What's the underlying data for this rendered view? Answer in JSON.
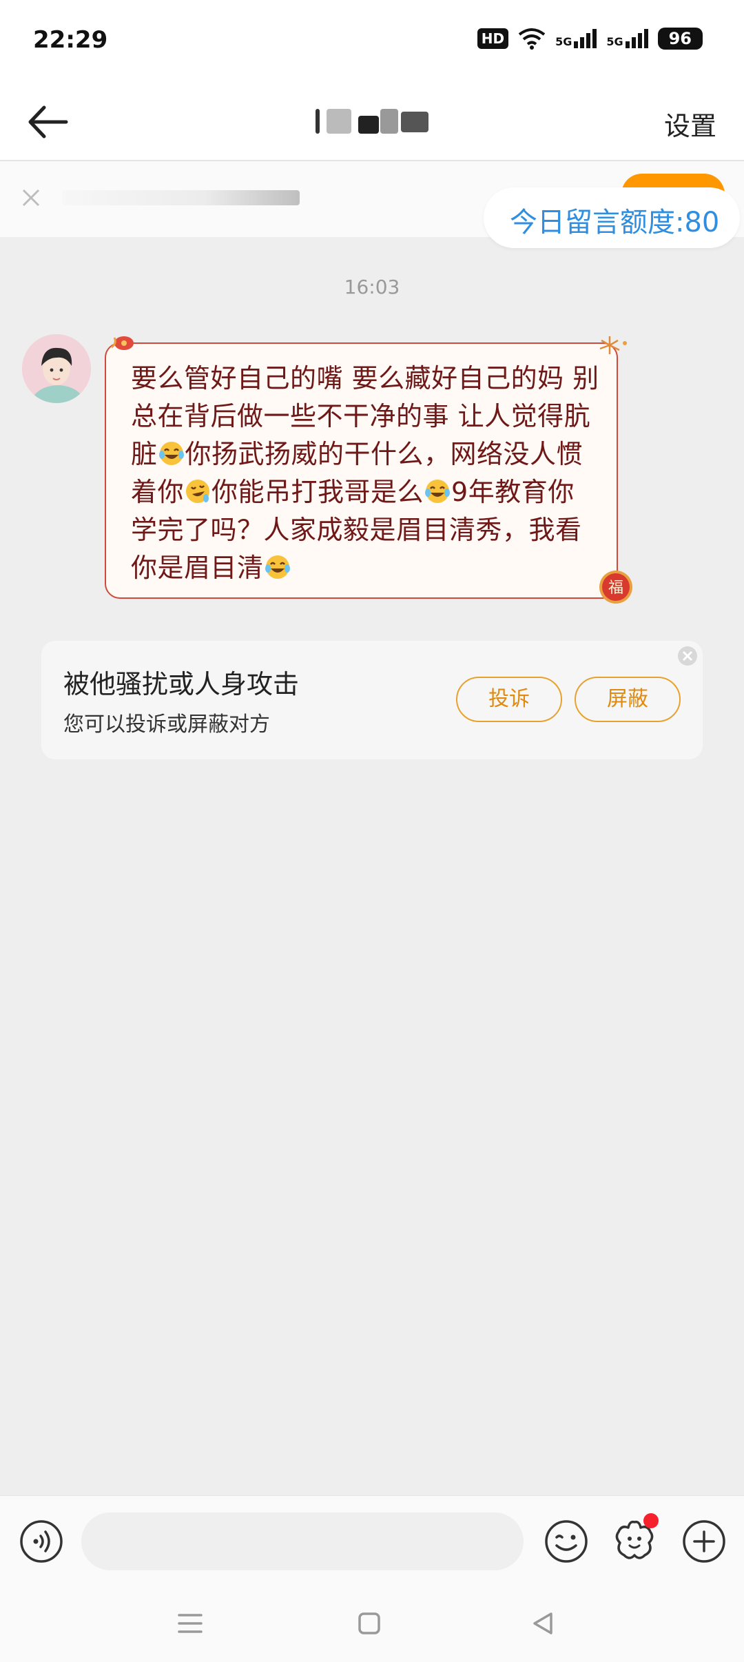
{
  "status_bar": {
    "time": "22:29",
    "hd_label": "HD",
    "network_label_1": "5G",
    "network_label_2": "5G",
    "battery": "96"
  },
  "header": {
    "settings_label": "设置"
  },
  "notice": {
    "quota_text": "今日留言额度:80"
  },
  "chat": {
    "timestamp": "16:03",
    "message": {
      "segments": [
        {
          "text": "要么管好自己的嘴 要么藏好自己的妈 别总在背后做一些不干净的事 让人觉得肮脏"
        },
        {
          "emoji": "laughing-tears"
        },
        {
          "text": "你扬武扬威的干什么，网络没人惯着你"
        },
        {
          "emoji": "rolling-laugh"
        },
        {
          "text": "你能吊打我哥是么"
        },
        {
          "emoji": "laughing-tears"
        },
        {
          "text": "9年教育你学完了吗？人家成毅是眉目清秀，我看你是眉目清"
        },
        {
          "emoji": "laughing-tears"
        }
      ]
    },
    "bubble_decoration": "福"
  },
  "report_card": {
    "title": "被他骚扰或人身攻击",
    "subtitle": "您可以投诉或屏蔽对方",
    "complain_label": "投诉",
    "block_label": "屏蔽"
  },
  "input_bar": {
    "placeholder": "",
    "icons": [
      "voice-icon",
      "emoji-icon",
      "sticker-icon",
      "plus-icon"
    ]
  },
  "colors": {
    "accent_blue": "#2f8ee0",
    "bubble_border": "#d1493b",
    "bubble_text": "#6e1818",
    "action_orange": "#e08a10",
    "badge_red": "#f5222d",
    "orange_button": "#ff9800"
  }
}
